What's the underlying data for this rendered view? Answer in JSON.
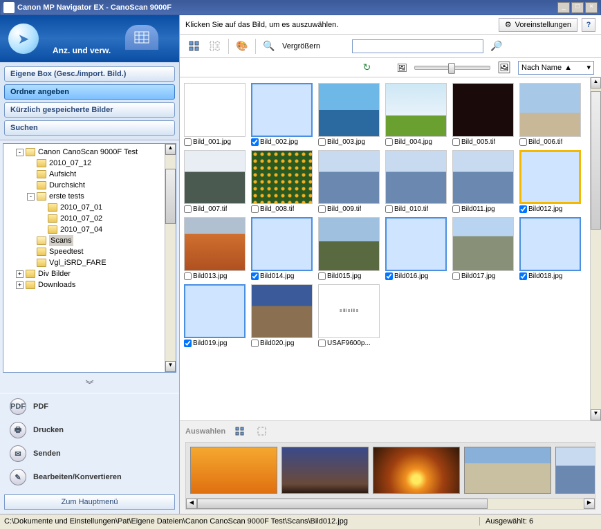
{
  "window": {
    "title": "Canon MP Navigator EX - CanoScan 9000F"
  },
  "banner": {
    "text": "Anz. und verw."
  },
  "nav": {
    "items": [
      "Eigene Box (Gesc./import. Bild.)",
      "Ordner angeben",
      "Kürzlich gespeicherte Bilder",
      "Suchen"
    ]
  },
  "tree": {
    "root": "Canon CanoScan 9000F Test",
    "items": [
      {
        "depth": 1,
        "label": "Canon CanoScan 9000F Test",
        "exp": "-",
        "open": true
      },
      {
        "depth": 2,
        "label": "2010_07_12"
      },
      {
        "depth": 2,
        "label": "Aufsicht"
      },
      {
        "depth": 2,
        "label": "Durchsicht"
      },
      {
        "depth": 2,
        "label": "erste tests",
        "exp": "-",
        "open": true
      },
      {
        "depth": 3,
        "label": "2010_07_01"
      },
      {
        "depth": 3,
        "label": "2010_07_02"
      },
      {
        "depth": 3,
        "label": "2010_07_04"
      },
      {
        "depth": 2,
        "label": "Scans",
        "open": true,
        "selected": true
      },
      {
        "depth": 2,
        "label": "Speedtest"
      },
      {
        "depth": 2,
        "label": "Vgl_iSRD_FARE"
      },
      {
        "depth": 1,
        "label": "Div Bilder",
        "exp": "+"
      },
      {
        "depth": 1,
        "label": "Downloads",
        "exp": "+"
      }
    ]
  },
  "actions": {
    "pdf": "PDF",
    "print": "Drucken",
    "send": "Senden",
    "edit": "Bearbeiten/Konvertieren",
    "mainmenu": "Zum Hauptmenü"
  },
  "topbar": {
    "hint": "Klicken Sie auf das Bild, um es auszuwählen.",
    "preferences": "Voreinstellungen",
    "zoom": "Vergrößern",
    "sort": "Nach Name"
  },
  "grid": {
    "items": [
      {
        "name": "Bild_001.jpg",
        "checked": false,
        "sel": false,
        "cls": "f-doc"
      },
      {
        "name": "Bild_002.jpg",
        "checked": true,
        "sel": true,
        "cls": "f-sun"
      },
      {
        "name": "Bild_003.jpg",
        "checked": false,
        "sel": false,
        "cls": "f-sea"
      },
      {
        "name": "Bild_004.jpg",
        "checked": false,
        "sel": false,
        "cls": "f-field"
      },
      {
        "name": "Bild_005.tif",
        "checked": false,
        "sel": false,
        "cls": "f-stars"
      },
      {
        "name": "Bild_006.tif",
        "checked": false,
        "sel": false,
        "cls": "f-ruin"
      },
      {
        "name": "Bild_007.tif",
        "checked": false,
        "sel": false,
        "cls": "f-snow"
      },
      {
        "name": "Bild_008.tif",
        "checked": false,
        "sel": false,
        "cls": "f-flowers"
      },
      {
        "name": "Bild_009.tif",
        "checked": false,
        "sel": false,
        "cls": "f-mtnblue"
      },
      {
        "name": "Bild_010.tif",
        "checked": false,
        "sel": false,
        "cls": "f-mtnblue"
      },
      {
        "name": "Bild011.jpg",
        "checked": false,
        "sel": false,
        "cls": "f-mtnblue"
      },
      {
        "name": "Bild012.jpg",
        "checked": true,
        "sel": true,
        "cls": "f-mtnsel",
        "hot": true
      },
      {
        "name": "Bild013.jpg",
        "checked": false,
        "sel": false,
        "cls": "f-autumn"
      },
      {
        "name": "Bild014.jpg",
        "checked": true,
        "sel": true,
        "cls": "f-dusk"
      },
      {
        "name": "Bild015.jpg",
        "checked": false,
        "sel": false,
        "cls": "f-hill"
      },
      {
        "name": "Bild016.jpg",
        "checked": true,
        "sel": true,
        "cls": "f-pano1"
      },
      {
        "name": "Bild017.jpg",
        "checked": false,
        "sel": false,
        "cls": "f-pano2"
      },
      {
        "name": "Bild018.jpg",
        "checked": true,
        "sel": true,
        "cls": "f-mtnblue"
      },
      {
        "name": "Bild019.jpg",
        "checked": true,
        "sel": true,
        "cls": "f-sunset"
      },
      {
        "name": "Bild020.jpg",
        "checked": false,
        "sel": false,
        "cls": "f-rocks"
      },
      {
        "name": "USAF9600p...",
        "checked": false,
        "sel": false,
        "cls": "f-test"
      }
    ]
  },
  "selection": {
    "label": "Auswahlen",
    "items": [
      "f-sun",
      "f-dusk",
      "f-sunset",
      "f-pano1",
      "f-mtnblue",
      "f-mtnsel"
    ]
  },
  "status": {
    "path": "C:\\Dokumente und Einstellungen\\Pat\\Eigene Dateien\\Canon CanoScan 9000F Test\\Scans\\Bild012.jpg",
    "selected_label": "Ausgewählt:",
    "selected_count": "6"
  }
}
